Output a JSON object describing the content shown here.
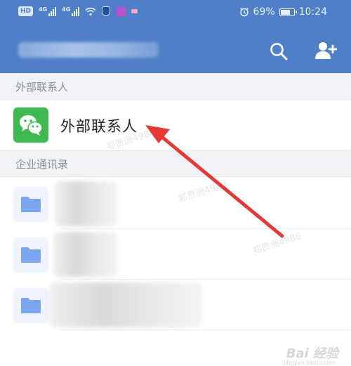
{
  "status_bar": {
    "network_badge": "HD",
    "signal_1_label": "4G",
    "signal_2_label": "4G",
    "battery": "69%",
    "time": "10:24"
  },
  "header": {
    "search_icon": "search-icon",
    "add_contact_icon": "add-contact-icon"
  },
  "sections": {
    "external_header": "外部联系人",
    "directory_header": "企业通讯录"
  },
  "external_contacts": {
    "icon": "wechat-icon",
    "label": "外部联系人"
  },
  "directory": {
    "folder_icon": "folder-icon",
    "items": [
      {
        "name": ""
      },
      {
        "name": ""
      },
      {
        "name": ""
      }
    ]
  },
  "colors": {
    "header_blue": "#4f7fc6",
    "wechat_green": "#3fb94f",
    "folder_blue": "#7aa7ef",
    "arrow_red": "#e53935"
  },
  "watermarks": {
    "overlay_1": "郑贾洲4986",
    "overlay_2": "郑贾洲4986",
    "overlay_3": "郑贾洲4986",
    "site_mark": "Bai 经验",
    "site_url": "jingyan.baidu.com"
  }
}
